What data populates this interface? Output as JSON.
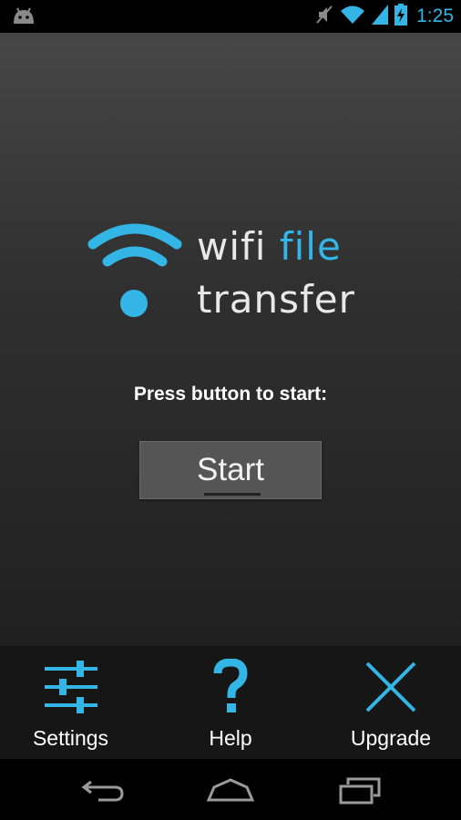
{
  "status_bar": {
    "time": "1:25",
    "icons": [
      "android-icon",
      "mute-icon",
      "wifi-signal-icon",
      "cell-signal-icon",
      "battery-charging-icon"
    ]
  },
  "app": {
    "logo": {
      "line1_a": "wifi ",
      "line1_b": "file",
      "line2": "transfer",
      "icon": "wifi-icon"
    },
    "prompt": "Press button to start:",
    "start_button": "Start"
  },
  "action_bar": {
    "items": [
      {
        "label": "Settings",
        "icon": "sliders-icon"
      },
      {
        "label": "Help",
        "icon": "question-icon"
      },
      {
        "label": "Upgrade",
        "icon": "close-x-icon"
      }
    ]
  },
  "nav_bar": {
    "items": [
      "back-icon",
      "home-icon",
      "recent-apps-icon"
    ]
  },
  "colors": {
    "accent": "#33b5e5",
    "background_top": "#474747",
    "background_bottom": "#202020",
    "action_bar": "#161616"
  }
}
